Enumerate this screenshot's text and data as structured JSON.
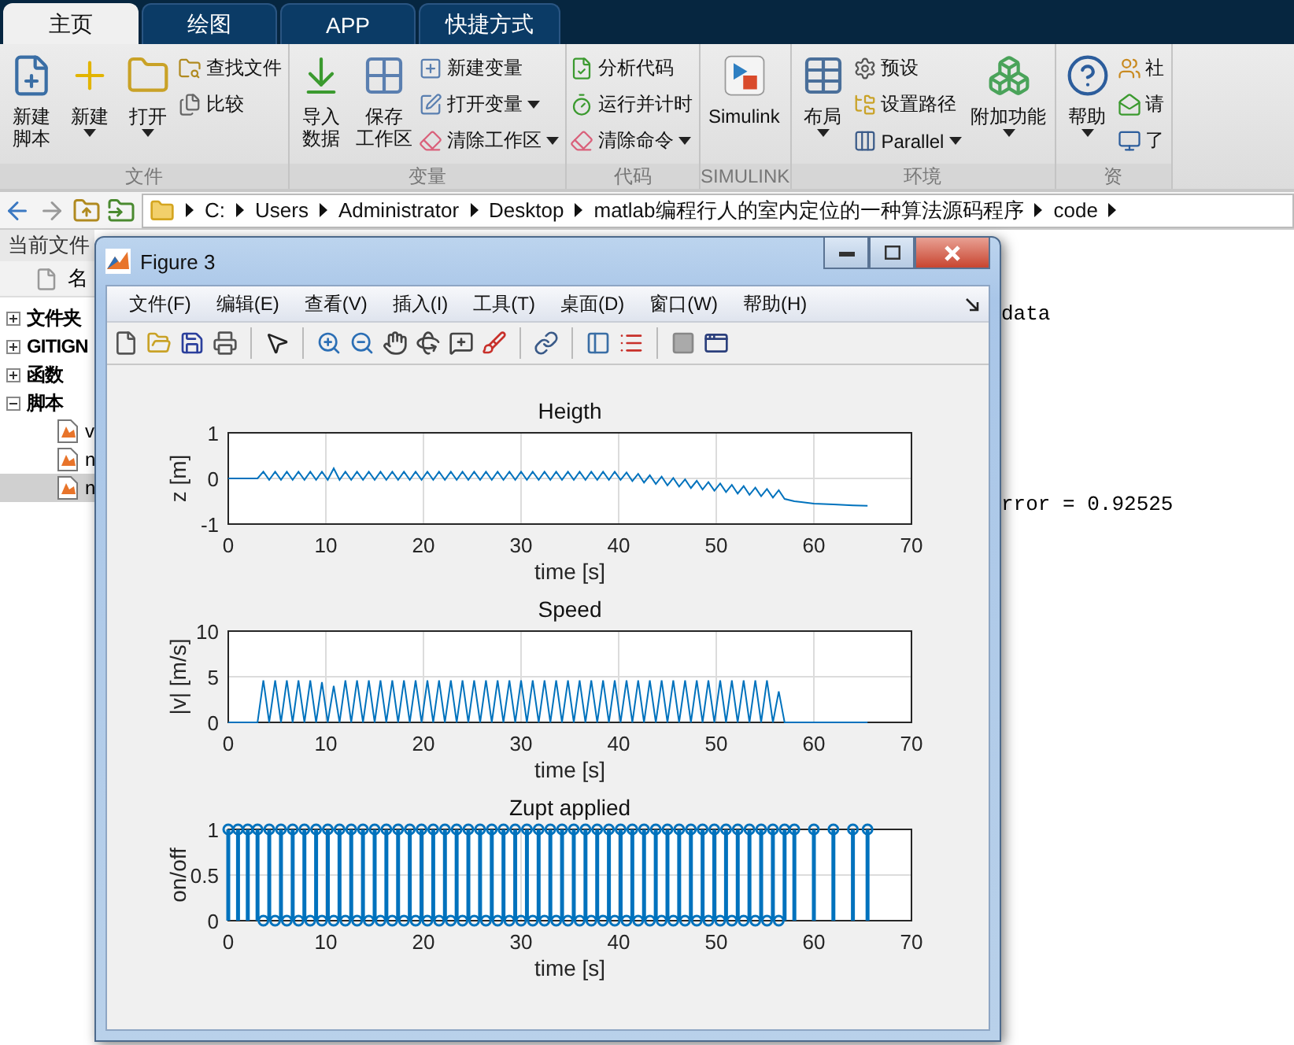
{
  "tabs": [
    {
      "label": "主页",
      "selected": true
    },
    {
      "label": "绘图",
      "selected": false
    },
    {
      "label": "APP",
      "selected": false
    },
    {
      "label": "快捷方式",
      "selected": false
    }
  ],
  "ribbon": {
    "sections": [
      {
        "label": "文件",
        "groups": [
          {
            "kind": "large",
            "lines": [
              "新建",
              "脚本"
            ],
            "menu": false
          },
          {
            "kind": "large",
            "lines": [
              "新建"
            ],
            "menu": true
          },
          {
            "kind": "large",
            "lines": [
              "打开"
            ],
            "menu": true
          },
          {
            "kind": "stack",
            "items": [
              {
                "label": "查找文件",
                "menu": false
              },
              {
                "label": "比较",
                "menu": false
              }
            ]
          }
        ]
      },
      {
        "label": "变量",
        "groups": [
          {
            "kind": "large",
            "lines": [
              "导入",
              "数据"
            ],
            "menu": false
          },
          {
            "kind": "large",
            "lines": [
              "保存",
              "工作区"
            ],
            "menu": false
          },
          {
            "kind": "stack",
            "items": [
              {
                "label": "新建变量",
                "menu": false
              },
              {
                "label": "打开变量",
                "menu": true
              },
              {
                "label": "清除工作区",
                "menu": true
              }
            ]
          }
        ]
      },
      {
        "label": "代码",
        "groups": [
          {
            "kind": "stack",
            "items": [
              {
                "label": "分析代码",
                "menu": false
              },
              {
                "label": "运行并计时",
                "menu": false
              },
              {
                "label": "清除命令",
                "menu": true
              }
            ]
          }
        ]
      },
      {
        "label": "SIMULINK",
        "groups": [
          {
            "kind": "large",
            "lines": [
              "Simulink"
            ],
            "menu": false
          }
        ]
      },
      {
        "label": "环境",
        "groups": [
          {
            "kind": "large",
            "lines": [
              "布局"
            ],
            "menu": true
          },
          {
            "kind": "stack",
            "items": [
              {
                "label": "预设",
                "menu": false
              },
              {
                "label": "设置路径",
                "menu": false
              },
              {
                "label": "Parallel",
                "menu": true
              }
            ]
          },
          {
            "kind": "large",
            "lines": [
              "附加功能"
            ],
            "menu": true
          }
        ]
      },
      {
        "label": "资",
        "groups": [
          {
            "kind": "large",
            "lines": [
              "帮助"
            ],
            "menu": true
          },
          {
            "kind": "stack",
            "items": [
              {
                "label": "社",
                "menu": false
              },
              {
                "label": "请",
                "menu": false
              },
              {
                "label": "了",
                "menu": false
              }
            ]
          }
        ]
      }
    ]
  },
  "address": {
    "path": [
      "C:",
      "Users",
      "Administrator",
      "Desktop",
      "matlab编程行人的室内定位的一种算法源码程序",
      "code"
    ]
  },
  "current_folder": {
    "title": "当前文件",
    "column": "名",
    "tree": [
      {
        "label": "文件夹",
        "expanded": false
      },
      {
        "label": "GITIGN",
        "expanded": false
      },
      {
        "label": "函数",
        "expanded": false
      },
      {
        "label": "脚本",
        "expanded": true,
        "children": [
          {
            "label": "v",
            "selected": false
          },
          {
            "label": "n",
            "selected": false
          },
          {
            "label": "n",
            "selected": true
          }
        ]
      }
    ]
  },
  "command_window": {
    "lines": [
      "data",
      "rror = 0.92525"
    ]
  },
  "figure": {
    "title": "Figure 3",
    "menu": [
      "文件(F)",
      "编辑(E)",
      "查看(V)",
      "插入(I)",
      "工具(T)",
      "桌面(D)",
      "窗口(W)",
      "帮助(H)"
    ],
    "axes": [
      {
        "chart_data": {
          "type": "line",
          "title": "Heigth",
          "xlabel": "time [s]",
          "ylabel": "z [m]",
          "xlim": [
            0,
            70
          ],
          "ylim": [
            -1,
            1
          ],
          "xticks": [
            0,
            10,
            20,
            30,
            40,
            50,
            60,
            70
          ],
          "yticks": [
            -1,
            0,
            1
          ],
          "grid": true,
          "x": [
            0,
            1,
            2,
            3,
            3.6,
            4.2,
            4.8,
            5.4,
            6,
            6.6,
            7.2,
            7.8,
            8.4,
            9,
            9.6,
            10.2,
            10.8,
            11.4,
            12,
            12.6,
            13.2,
            13.8,
            14.4,
            15,
            15.6,
            16.2,
            16.8,
            17.4,
            18,
            18.6,
            19.2,
            19.8,
            20.4,
            21,
            21.6,
            22.2,
            22.8,
            23.4,
            24,
            24.6,
            25.2,
            25.8,
            26.4,
            27,
            27.6,
            28.2,
            28.8,
            29.4,
            30,
            30.6,
            31.2,
            31.8,
            32.4,
            33,
            33.6,
            34.2,
            34.8,
            35.4,
            36,
            36.6,
            37.2,
            37.8,
            38.4,
            39,
            39.6,
            40.2,
            40.8,
            41.4,
            42,
            42.6,
            43.2,
            43.8,
            44.4,
            45,
            45.6,
            46.2,
            46.8,
            47.4,
            48,
            48.6,
            49.2,
            49.8,
            50.4,
            51,
            51.6,
            52.2,
            52.8,
            53.4,
            54,
            54.6,
            55.2,
            55.8,
            56.4,
            57,
            58,
            60,
            62,
            64,
            65.5
          ],
          "series": [
            {
              "color": "#0072bd",
              "values": [
                0,
                0,
                0,
                0,
                0.15,
                -0.03,
                0.15,
                -0.03,
                0.15,
                -0.03,
                0.15,
                -0.03,
                0.15,
                -0.03,
                0.15,
                -0.03,
                0.22,
                -0.03,
                0.15,
                -0.03,
                0.15,
                -0.03,
                0.15,
                -0.03,
                0.15,
                -0.03,
                0.15,
                -0.03,
                0.15,
                -0.03,
                0.15,
                -0.03,
                0.15,
                -0.03,
                0.15,
                -0.03,
                0.15,
                -0.03,
                0.15,
                -0.03,
                0.15,
                -0.03,
                0.15,
                -0.03,
                0.15,
                -0.03,
                0.15,
                -0.03,
                0.15,
                -0.03,
                0.15,
                -0.03,
                0.15,
                -0.03,
                0.15,
                -0.03,
                0.15,
                -0.03,
                0.15,
                -0.03,
                0.15,
                -0.03,
                0.15,
                -0.03,
                0.15,
                -0.03,
                0.13,
                -0.06,
                0.1,
                -0.09,
                0.07,
                -0.12,
                0.04,
                -0.15,
                0.01,
                -0.18,
                -0.02,
                -0.21,
                -0.05,
                -0.24,
                -0.08,
                -0.27,
                -0.11,
                -0.3,
                -0.14,
                -0.33,
                -0.17,
                -0.36,
                -0.2,
                -0.39,
                -0.23,
                -0.42,
                -0.26,
                -0.45,
                -0.5,
                -0.55,
                -0.57,
                -0.59,
                -0.6
              ]
            }
          ]
        }
      },
      {
        "chart_data": {
          "type": "line",
          "title": "Speed",
          "xlabel": "time [s]",
          "ylabel": "|v| [m/s]",
          "xlim": [
            0,
            70
          ],
          "ylim": [
            0,
            10
          ],
          "xticks": [
            0,
            10,
            20,
            30,
            40,
            50,
            60,
            70
          ],
          "yticks": [
            0,
            5,
            10
          ],
          "grid": true,
          "x": [
            0,
            1,
            2,
            3,
            3.6,
            4.2,
            4.8,
            5.4,
            6,
            6.6,
            7.2,
            7.8,
            8.4,
            9,
            9.6,
            10.2,
            10.8,
            11.4,
            12,
            12.6,
            13.2,
            13.8,
            14.4,
            15,
            15.6,
            16.2,
            16.8,
            17.4,
            18,
            18.6,
            19.2,
            19.8,
            20.4,
            21,
            21.6,
            22.2,
            22.8,
            23.4,
            24,
            24.6,
            25.2,
            25.8,
            26.4,
            27,
            27.6,
            28.2,
            28.8,
            29.4,
            30,
            30.6,
            31.2,
            31.8,
            32.4,
            33,
            33.6,
            34.2,
            34.8,
            35.4,
            36,
            36.6,
            37.2,
            37.8,
            38.4,
            39,
            39.6,
            40.2,
            40.8,
            41.4,
            42,
            42.6,
            43.2,
            43.8,
            44.4,
            45,
            45.6,
            46.2,
            46.8,
            47.4,
            48,
            48.6,
            49.2,
            49.8,
            50.4,
            51,
            51.6,
            52.2,
            52.8,
            53.4,
            54,
            54.6,
            55.2,
            55.8,
            56.4,
            57,
            58,
            60,
            62,
            64,
            65.5
          ],
          "series": [
            {
              "color": "#0072bd",
              "values": [
                0,
                0,
                0,
                0,
                4.6,
                0,
                4.6,
                0,
                4.6,
                0,
                4.6,
                0,
                4.6,
                0,
                4.4,
                0,
                4.0,
                0,
                4.6,
                0,
                4.6,
                0,
                4.6,
                0,
                4.6,
                0,
                4.6,
                0,
                4.6,
                0,
                4.6,
                0,
                4.6,
                0,
                4.6,
                0,
                4.6,
                0,
                4.6,
                0,
                4.6,
                0,
                4.6,
                0,
                4.6,
                0,
                4.6,
                0,
                4.6,
                0,
                4.6,
                0,
                4.6,
                0,
                4.6,
                0,
                4.6,
                0,
                4.6,
                0,
                4.6,
                0,
                4.6,
                0,
                4.6,
                0,
                4.6,
                0,
                4.6,
                0,
                4.6,
                0,
                4.6,
                0,
                4.6,
                0,
                4.6,
                0,
                4.6,
                0,
                4.6,
                0,
                4.6,
                0,
                4.6,
                0,
                4.6,
                0,
                4.6,
                0,
                4.6,
                0,
                3.4,
                0,
                0,
                0,
                0,
                0,
                0
              ]
            }
          ]
        }
      },
      {
        "chart_data": {
          "type": "scatter",
          "title": "Zupt applied",
          "xlabel": "time [s]",
          "ylabel": "on/off",
          "xlim": [
            0,
            70
          ],
          "ylim": [
            0,
            1
          ],
          "xticks": [
            0,
            10,
            20,
            30,
            40,
            50,
            60,
            70
          ],
          "yticks": [
            0,
            0.5,
            1
          ],
          "grid": true,
          "x": [
            0,
            1,
            2,
            3,
            3.6,
            4.2,
            4.8,
            5.4,
            6,
            6.6,
            7.2,
            7.8,
            8.4,
            9,
            9.6,
            10.2,
            10.8,
            11.4,
            12,
            12.6,
            13.2,
            13.8,
            14.4,
            15,
            15.6,
            16.2,
            16.8,
            17.4,
            18,
            18.6,
            19.2,
            19.8,
            20.4,
            21,
            21.6,
            22.2,
            22.8,
            23.4,
            24,
            24.6,
            25.2,
            25.8,
            26.4,
            27,
            27.6,
            28.2,
            28.8,
            29.4,
            30,
            30.6,
            31.2,
            31.8,
            32.4,
            33,
            33.6,
            34.2,
            34.8,
            35.4,
            36,
            36.6,
            37.2,
            37.8,
            38.4,
            39,
            39.6,
            40.2,
            40.8,
            41.4,
            42,
            42.6,
            43.2,
            43.8,
            44.4,
            45,
            45.6,
            46.2,
            46.8,
            47.4,
            48,
            48.6,
            49.2,
            49.8,
            50.4,
            51,
            51.6,
            52.2,
            52.8,
            53.4,
            54,
            54.6,
            55.2,
            55.8,
            56.4,
            57,
            58,
            60,
            62,
            64,
            65.5
          ],
          "series": [
            {
              "color": "#0072bd",
              "values": [
                1,
                1,
                1,
                1,
                0,
                1,
                0,
                1,
                0,
                1,
                0,
                1,
                0,
                1,
                0,
                1,
                0,
                1,
                0,
                1,
                0,
                1,
                0,
                1,
                0,
                1,
                0,
                1,
                0,
                1,
                0,
                1,
                0,
                1,
                0,
                1,
                0,
                1,
                0,
                1,
                0,
                1,
                0,
                1,
                0,
                1,
                0,
                1,
                0,
                1,
                0,
                1,
                0,
                1,
                0,
                1,
                0,
                1,
                0,
                1,
                0,
                1,
                0,
                1,
                0,
                1,
                0,
                1,
                0,
                1,
                0,
                1,
                0,
                1,
                0,
                1,
                0,
                1,
                0,
                1,
                0,
                1,
                0,
                1,
                0,
                1,
                0,
                1,
                0,
                1,
                0,
                1,
                0,
                1,
                1,
                1,
                1,
                1,
                1
              ]
            }
          ]
        }
      }
    ]
  }
}
